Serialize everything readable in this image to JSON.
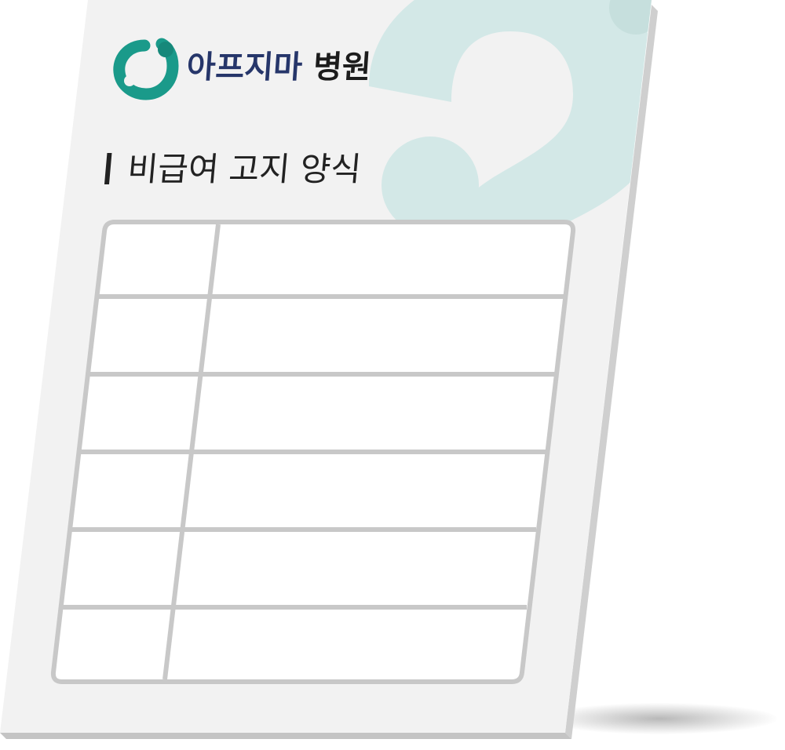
{
  "document": {
    "logo": {
      "name": "아프지마",
      "suffix": "병원",
      "icon": "hospital-ring-logo-icon",
      "name_color": "#26366a",
      "icon_color": "#1a9a8a"
    },
    "title": "비급여 고지 양식",
    "form_table": {
      "rows": 6,
      "columns": 2,
      "cells": [
        [
          "",
          ""
        ],
        [
          "",
          ""
        ],
        [
          "",
          ""
        ],
        [
          "",
          ""
        ],
        [
          "",
          ""
        ],
        [
          "",
          ""
        ]
      ]
    },
    "colors": {
      "paper": "#f2f2f2",
      "paper_edge": "#cfcfcf",
      "accent_question_mark": "#d3e8e7",
      "table_lines": "#c8c8c8",
      "table_fill": "#ffffff"
    }
  }
}
